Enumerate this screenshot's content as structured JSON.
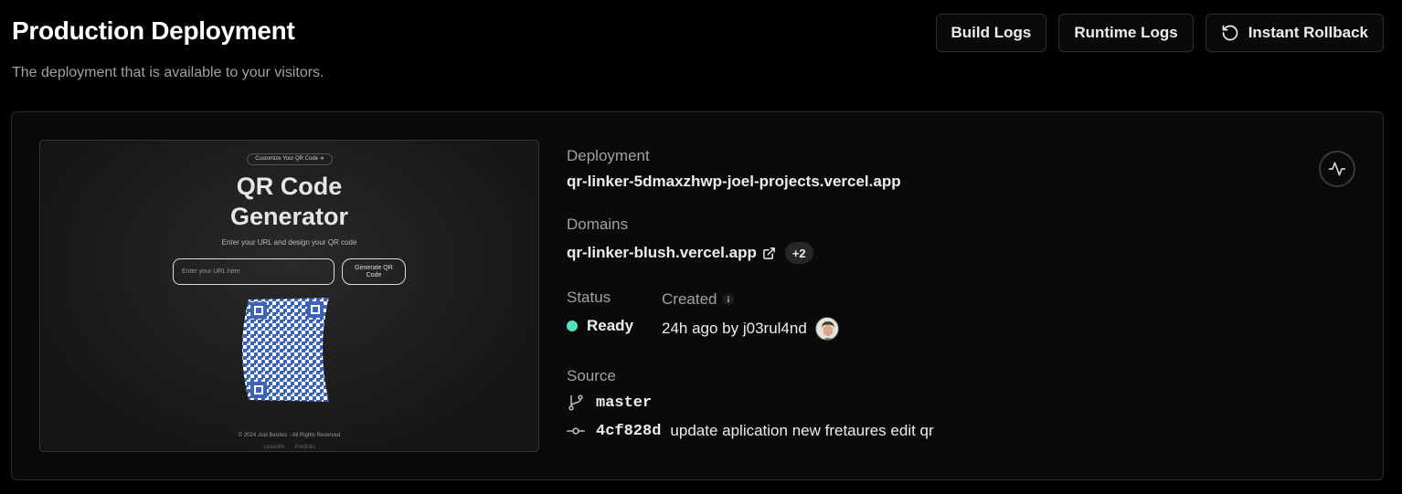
{
  "header": {
    "title": "Production Deployment",
    "subtitle": "The deployment that is available to your visitors."
  },
  "actions": {
    "build_logs": "Build Logs",
    "runtime_logs": "Runtime Logs",
    "instant_rollback": "Instant Rollback"
  },
  "preview": {
    "badge": "Customize Your QR Code ➔",
    "title_line1": "QR Code",
    "title_line2": "Generator",
    "subtitle": "Enter your URL and design your QR code",
    "input_placeholder": "Enter your URL here",
    "button_label": "Generate QR Code",
    "footer": "© 2024 Joel Benitez - All Rights Reserved",
    "links": [
      "LinkedIn",
      "Portfolio"
    ],
    "qr_color": "#3d63b5"
  },
  "deployment": {
    "label": "Deployment",
    "url": "qr-linker-5dmaxzhwp-joel-projects.vercel.app"
  },
  "domains": {
    "label": "Domains",
    "primary": "qr-linker-blush.vercel.app",
    "extra_count": "+2"
  },
  "status": {
    "label": "Status",
    "value": "Ready",
    "color": "#50e3c2"
  },
  "created": {
    "label": "Created",
    "value": "24h ago by j03rul4nd"
  },
  "source": {
    "label": "Source",
    "branch": "master",
    "commit_hash": "4cf828d",
    "commit_message": "update aplication new fretaures edit qr"
  },
  "icons": {
    "rollback": "rotate-ccw-icon",
    "external": "external-link-icon",
    "info": "info-icon",
    "branch": "git-branch-icon",
    "commit": "git-commit-icon",
    "activity": "activity-icon"
  }
}
